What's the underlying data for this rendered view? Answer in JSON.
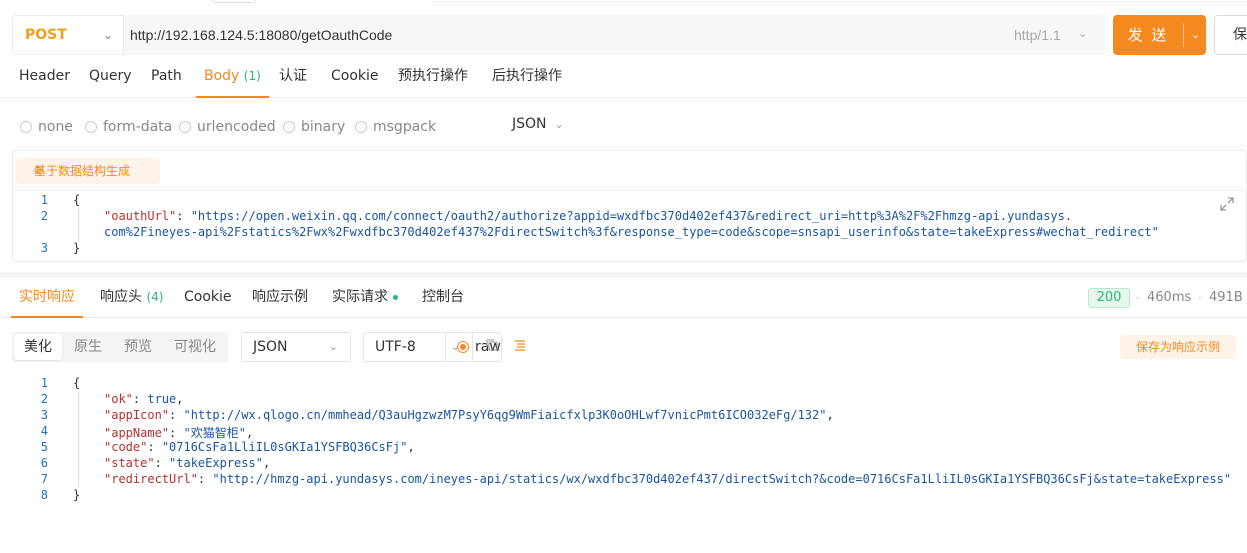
{
  "request": {
    "method": "POST",
    "url": "http://192.168.124.5:18080/getOauthCode",
    "http_version": "http/1.1",
    "send_label": "发 送",
    "save_label": "保"
  },
  "request_tabs": [
    {
      "label": "Header"
    },
    {
      "label": "Query"
    },
    {
      "label": "Path"
    },
    {
      "label": "Body",
      "count": "(1)"
    },
    {
      "label": "认证"
    },
    {
      "label": "Cookie"
    },
    {
      "label": "预执行操作"
    },
    {
      "label": "后执行操作"
    }
  ],
  "body_types": [
    "none",
    "form-data",
    "urlencoded",
    "binary",
    "msgpack",
    "raw"
  ],
  "body_format": "JSON",
  "generate_label": "基于数据结构生成",
  "request_body": {
    "line_numbers": [
      "1",
      "2",
      "3"
    ],
    "open": "{",
    "key": "\"oauthUrl\"",
    "colon": ": ",
    "value_part1": "\"https://open.weixin.qq.com/connect/oauth2/authorize?appid=wxdfbc370d402ef437&redirect_uri=http%3A%2F%2Fhmzg-api.yundasys.",
    "value_part2": "com%2Fineyes-api%2Fstatics%2Fwx%2Fwxdfbc370d402ef437%2FdirectSwitch%3f&response_type=code&scope=snsapi_userinfo&state=takeExpress#wechat_redirect\"",
    "close": "}"
  },
  "response_tabs": [
    {
      "label": "实时响应"
    },
    {
      "label": "响应头",
      "count": "(4)"
    },
    {
      "label": "Cookie"
    },
    {
      "label": "响应示例"
    },
    {
      "label": "实际请求"
    },
    {
      "label": "控制台"
    }
  ],
  "response_meta": {
    "status": "200",
    "time": "460ms",
    "size": "491B",
    "sep": "·"
  },
  "view_modes": [
    "美化",
    "原生",
    "预览",
    "可视化"
  ],
  "response_format": "JSON",
  "response_encoding": "UTF-8",
  "save_sample_label": "保存为响应示例",
  "response_body": {
    "line_numbers": [
      "1",
      "2",
      "3",
      "4",
      "5",
      "6",
      "7",
      "8"
    ],
    "open": "{",
    "close": "}",
    "ok_key": "\"ok\"",
    "ok_val": "true",
    "appIcon_key": "\"appIcon\"",
    "appIcon_val": "\"http://wx.qlogo.cn/mmhead/Q3auHgzwzM7PsyY6qg9WmFiaicfxlp3K0oOHLwf7vnicPmt6ICO032eFg/132\"",
    "appName_key": "\"appName\"",
    "appName_val": "\"欢猫智柜\"",
    "code_key": "\"code\"",
    "code_val": "\"0716CsFa1LliIL0sGKIa1YSFBQ36CsFj\"",
    "state_key": "\"state\"",
    "state_val": "\"takeExpress\"",
    "redirectUrl_key": "\"redirectUrl\"",
    "redirectUrl_val": "\"http://hmzg-api.yundasys.com/ineyes-api/statics/wx/wxdfbc370d402ef437/directSwitch?&code=0716CsFa1LliIL0sGKIa1YSFBQ36CsFj&state=takeExpress\"",
    "sep": ": ",
    "comma": ","
  },
  "colors": {
    "accent": "#f5891f",
    "method": "#f0a020",
    "success": "#2bb673",
    "json_key": "#b8312f",
    "json_string": "#1a56a0"
  }
}
